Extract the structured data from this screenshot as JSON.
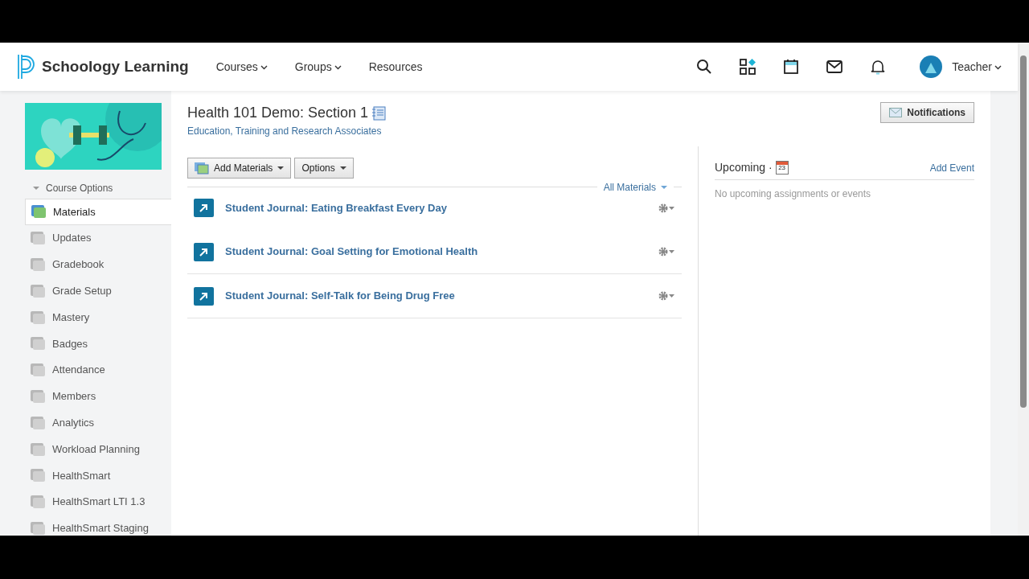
{
  "navbar": {
    "brand": "Schoology Learning",
    "menu": [
      {
        "label": "Courses",
        "dropdown": true
      },
      {
        "label": "Groups",
        "dropdown": true
      },
      {
        "label": "Resources",
        "dropdown": false
      }
    ],
    "user": "Teacher"
  },
  "sidebar": {
    "course_options": "Course Options",
    "items": [
      {
        "label": "Materials",
        "selected": true
      },
      {
        "label": "Updates",
        "selected": false
      },
      {
        "label": "Gradebook",
        "selected": false
      },
      {
        "label": "Grade Setup",
        "selected": false
      },
      {
        "label": "Mastery",
        "selected": false
      },
      {
        "label": "Badges",
        "selected": false
      },
      {
        "label": "Attendance",
        "selected": false
      },
      {
        "label": "Members",
        "selected": false
      },
      {
        "label": "Analytics",
        "selected": false
      },
      {
        "label": "Workload Planning",
        "selected": false
      },
      {
        "label": "HealthSmart",
        "selected": false
      },
      {
        "label": "HealthSmart LTI 1.3",
        "selected": false
      },
      {
        "label": "HealthSmart Staging",
        "selected": false
      }
    ]
  },
  "course": {
    "title": "Health 101 Demo: Section 1",
    "subtitle": "Education, Training and Research Associates"
  },
  "notifications_button": "Notifications",
  "toolbar": {
    "add_materials": "Add Materials",
    "options": "Options",
    "filter": "All Materials"
  },
  "materials": [
    {
      "title": "Student Journal: Eating Breakfast Every Day"
    },
    {
      "title": "Student Journal: Goal Setting for Emotional Health"
    },
    {
      "title": "Student Journal: Self-Talk for Being Drug Free"
    }
  ],
  "upcoming": {
    "title": "Upcoming ·",
    "calendar_day": "23",
    "add_event": "Add Event",
    "empty": "No upcoming assignments or events"
  }
}
